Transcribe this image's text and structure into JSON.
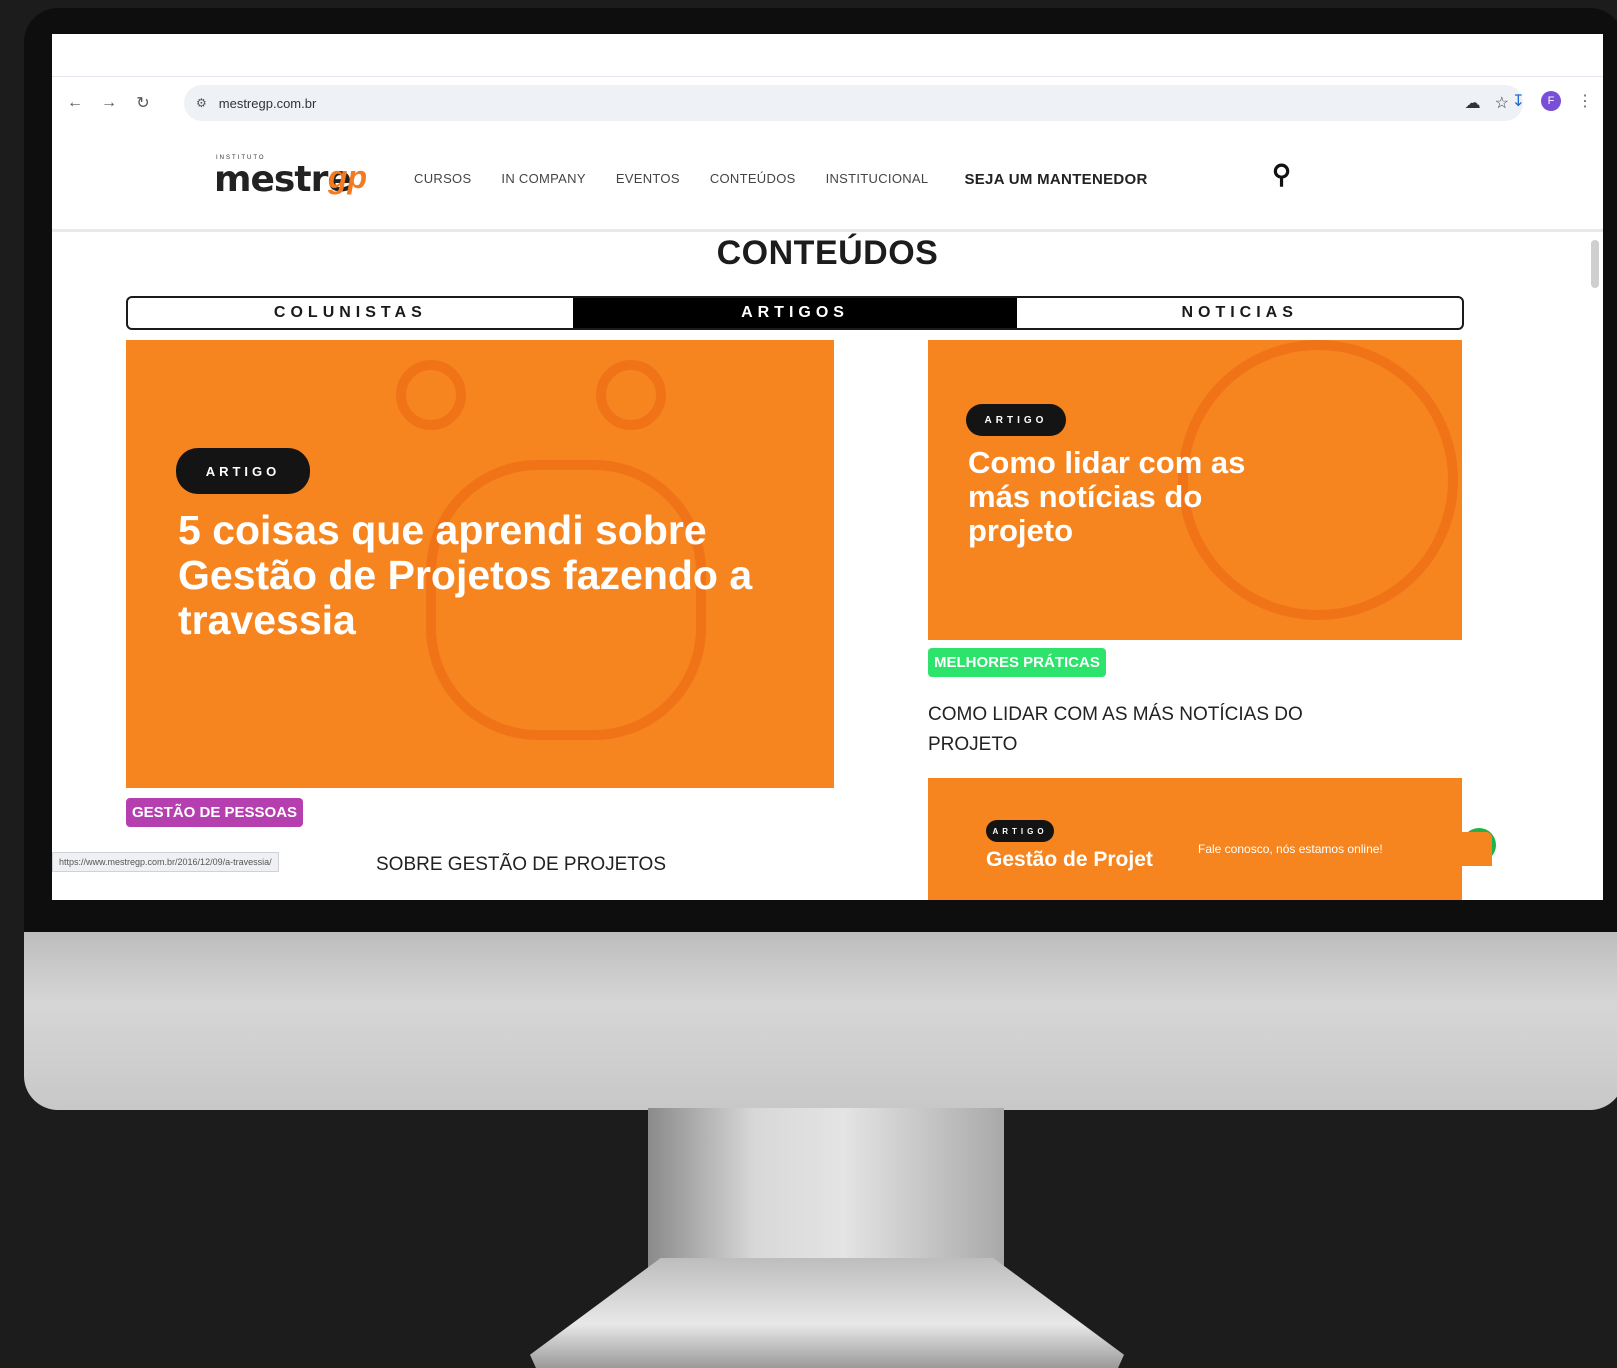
{
  "browser": {
    "url": "mestregp.com.br",
    "avatar_letter": "F",
    "status_url": "https://www.mestregp.com.br/2016/12/09/a-travessia/"
  },
  "site": {
    "logo_small": "INSTITUTO",
    "logo_main": "mestre",
    "logo_accent": "gp",
    "menu": [
      "CURSOS",
      "IN COMPANY",
      "EVENTOS",
      "CONTEÚDOS",
      "INSTITUCIONAL"
    ],
    "cta": "SEJA UM MANTENEDOR"
  },
  "page": {
    "title": "CONTEÚDOS",
    "tabs": [
      {
        "label": "COLUNISTAS",
        "active": false
      },
      {
        "label": "ARTIGOS",
        "active": true
      },
      {
        "label": "NOTICIAS",
        "active": false
      }
    ]
  },
  "cards": {
    "big": {
      "pill": "ARTIGO",
      "headline": "5 coisas que aprendi sobre Gestão de Projetos fazendo a travessia",
      "category": "GESTÃO DE PESSOAS",
      "category_color": "#b63fb0",
      "caption_visible": "SOBRE GESTÃO DE PROJETOS"
    },
    "small": {
      "pill": "ARTIGO",
      "headline": "Como lidar com as más notícias do projeto",
      "category": "MELHORES PRÁTICAS",
      "category_color": "#2ee36b",
      "caption": "COMO LIDAR COM AS MÁS NOTÍCIAS DO PROJETO"
    },
    "third": {
      "pill": "ARTIGO",
      "headline": "Gestão de Projet"
    }
  },
  "chat": {
    "text": "Fale conosco, nós estamos online!"
  },
  "colors": {
    "accent": "#f6851f",
    "dark": "#141414"
  }
}
